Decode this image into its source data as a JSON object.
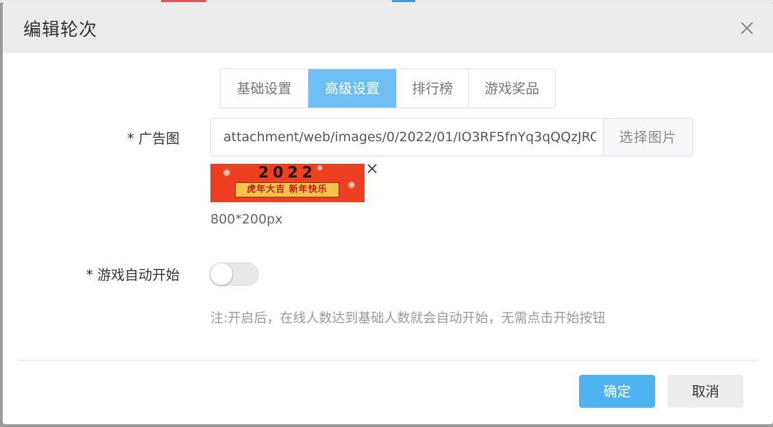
{
  "dialog": {
    "title": "编辑轮次"
  },
  "tabs": [
    {
      "label": "基础设置",
      "active": false
    },
    {
      "label": "高级设置",
      "active": true
    },
    {
      "label": "排行榜",
      "active": false
    },
    {
      "label": "游戏奖品",
      "active": false
    }
  ],
  "ad_image": {
    "label": "* 广告图",
    "value": "attachment/web/images/0/2022/01/IO3RF5fnYq3qQQzJRC",
    "select_button": "选择图片",
    "preview": {
      "year_text": "2022",
      "banner_text": "虎年大吉 新年快乐"
    },
    "size_hint": "800*200px"
  },
  "auto_start": {
    "label": "* 游戏自动开始",
    "enabled": false,
    "note": "注:开启后，在线人数达到基础人数就会自动开始，无需点击开始按钮"
  },
  "footer": {
    "confirm_label": "确定",
    "cancel_label": "取消"
  },
  "colors": {
    "accent": "#6ec0f4",
    "confirm": "#4fb3f0",
    "ad_background": "#ef3f22"
  }
}
